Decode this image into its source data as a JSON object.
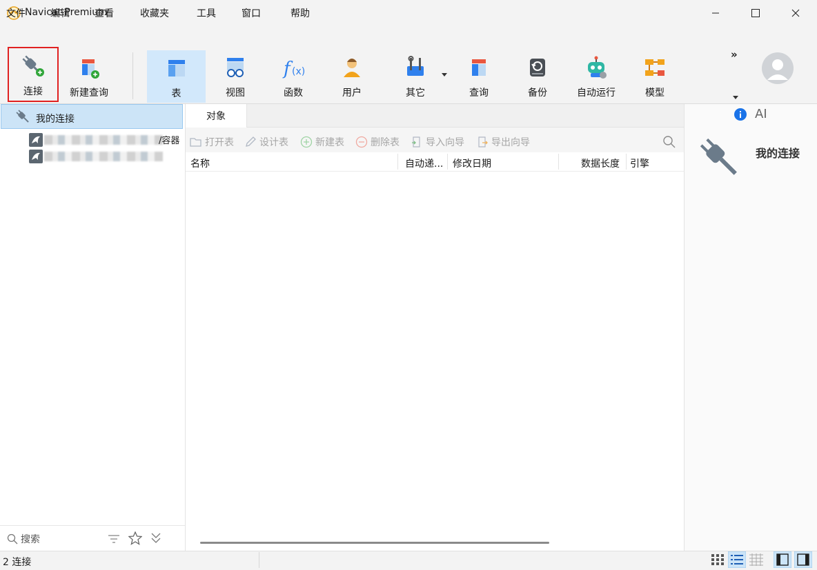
{
  "window": {
    "title": "Navicat Premium"
  },
  "menu": [
    "文件",
    "编辑",
    "查看",
    "收藏夹",
    "工具",
    "窗口",
    "帮助"
  ],
  "toolbar": {
    "connect": "连接",
    "new_query": "新建查询",
    "table": "表",
    "view": "视图",
    "function": "函数",
    "user": "用户",
    "other": "其它",
    "query": "查询",
    "backup": "备份",
    "automation": "自动运行",
    "model": "模型",
    "more": "»"
  },
  "tree": {
    "root_label": "我的连接",
    "item_suffix": "/容器"
  },
  "tabs": {
    "objects": "对象"
  },
  "object_actions": {
    "open_table": "打开表",
    "design_table": "设计表",
    "new_table": "新建表",
    "delete_table": "删除表",
    "import_wizard": "导入向导",
    "export_wizard": "导出向导"
  },
  "columns": {
    "name": "名称",
    "auto_increment": "自动递...",
    "modified_date": "修改日期",
    "data_length": "数据长度",
    "engine": "引擎"
  },
  "right_panel": {
    "ai_label": "AI",
    "connection_title": "我的连接"
  },
  "search": {
    "placeholder": "搜索"
  },
  "status": {
    "connections": "2 连接"
  },
  "colors": {
    "accent": "#1a73e8",
    "active_tab": "#d2e8fb",
    "highlight_border": "#e02020"
  }
}
